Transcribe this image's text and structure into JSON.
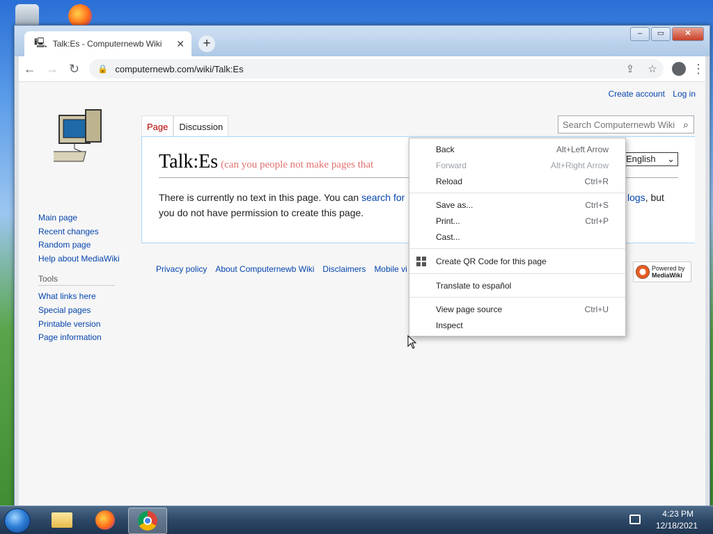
{
  "browser": {
    "tab_title": "Talk:Es - Computernewb Wiki",
    "url": "computernewb.com/wiki/Talk:Es"
  },
  "wiki": {
    "create_account": "Create account",
    "log_in": "Log in",
    "tab_page": "Page",
    "tab_discussion": "Discussion",
    "search_placeholder": "Search Computernewb Wiki",
    "title": "Talk:Es",
    "title_sub": "(can you people not make pages that",
    "language": "English",
    "body_1": "There is currently no text in this page. You can ",
    "body_link": "search for",
    "body_logs": "logs",
    "body_2": ", but",
    "body_3": "you do not have permission to create this page.",
    "sidebar_nav": [
      "Main page",
      "Recent changes",
      "Random page",
      "Help about MediaWiki"
    ],
    "tools_heading": "Tools",
    "tools": [
      "What links here",
      "Special pages",
      "Printable version",
      "Page information"
    ],
    "footer": [
      "Privacy policy",
      "About Computernewb Wiki",
      "Disclaimers",
      "Mobile vi"
    ],
    "powered_by": "Powered by",
    "mediawiki": "MediaWiki"
  },
  "context_menu": {
    "back": {
      "label": "Back",
      "shortcut": "Alt+Left Arrow"
    },
    "forward": {
      "label": "Forward",
      "shortcut": "Alt+Right Arrow"
    },
    "reload": {
      "label": "Reload",
      "shortcut": "Ctrl+R"
    },
    "save_as": {
      "label": "Save as...",
      "shortcut": "Ctrl+S"
    },
    "print": {
      "label": "Print...",
      "shortcut": "Ctrl+P"
    },
    "cast": {
      "label": "Cast..."
    },
    "qr": {
      "label": "Create QR Code for this page"
    },
    "translate": {
      "label": "Translate to español"
    },
    "view_source": {
      "label": "View page source",
      "shortcut": "Ctrl+U"
    },
    "inspect": {
      "label": "Inspect"
    }
  },
  "taskbar": {
    "time": "4:23 PM",
    "date": "12/18/2021"
  }
}
